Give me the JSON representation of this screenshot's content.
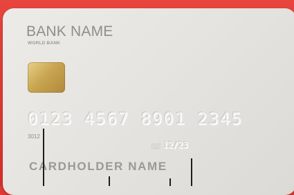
{
  "card": {
    "bank_name": "BANK NAME",
    "bank_subtitle": "WORLD BANK",
    "number_groups": [
      "0123",
      "4567",
      "8901",
      "2345"
    ],
    "small_number": "3012",
    "valid_label": "VALID\nTHRU",
    "expiry": "12/23",
    "holder": "CARDHOLDER NAME"
  },
  "colors": {
    "background": "#e23a35",
    "card": "#e9e8e5",
    "chip": "#c9a652"
  }
}
